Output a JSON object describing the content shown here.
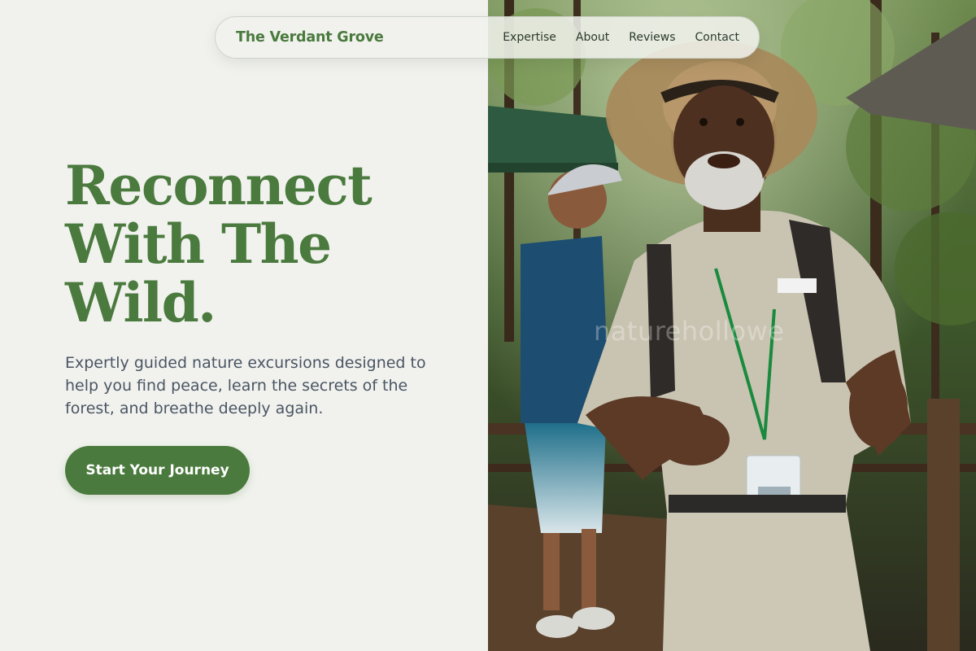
{
  "nav": {
    "brand": "The Verdant Grove",
    "links": [
      "Expertise",
      "About",
      "Reviews",
      "Contact"
    ]
  },
  "hero": {
    "title_lines": [
      "Reconnect",
      "With The",
      "Wild."
    ],
    "subtitle": "Expertly guided nature excursions designed to help you find peace, learn the secrets of the forest, and breathe deeply again.",
    "cta_label": "Start Your Journey",
    "image_watermark": "naturehollowe"
  },
  "colors": {
    "accent": "#4a7a3d",
    "background": "#f1f2ee",
    "text_muted": "#4a5563"
  }
}
